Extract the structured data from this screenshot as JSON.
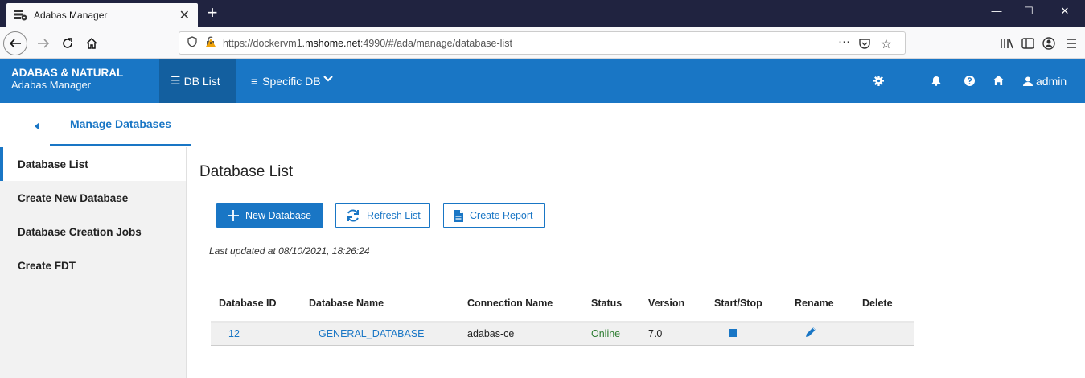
{
  "browser": {
    "tab_title": "Adabas Manager",
    "url_prefix": "https://dockervm1.",
    "url_domain": "mshome.net",
    "url_rest": ":4990/#/ada/manage/database-list",
    "more_dots": "···"
  },
  "header": {
    "brand_title": "ADABAS & NATURAL",
    "brand_sub": "Adabas Manager",
    "nav_db_list": "DB List",
    "nav_specific_db": "Specific DB",
    "user_label": "admin",
    "accent_color": "#1976c5"
  },
  "subheader": {
    "tab_label": "Manage Databases"
  },
  "sidebar": {
    "items": [
      {
        "label": "Database List"
      },
      {
        "label": "Create New Database"
      },
      {
        "label": "Database Creation Jobs"
      },
      {
        "label": "Create FDT"
      }
    ]
  },
  "main": {
    "title": "Database List",
    "btn_new": "New Database",
    "btn_refresh": "Refresh List",
    "btn_report": "Create Report",
    "last_updated": "Last updated at 08/10/2021, 18:26:24",
    "table": {
      "headers": [
        "Database ID",
        "Database Name",
        "Connection Name",
        "Status",
        "Version",
        "Start/Stop",
        "Rename",
        "Delete"
      ],
      "rows": [
        {
          "id": "12",
          "name": "GENERAL_DATABASE",
          "connection": "adabas-ce",
          "status": "Online",
          "version": "7.0"
        }
      ]
    }
  }
}
